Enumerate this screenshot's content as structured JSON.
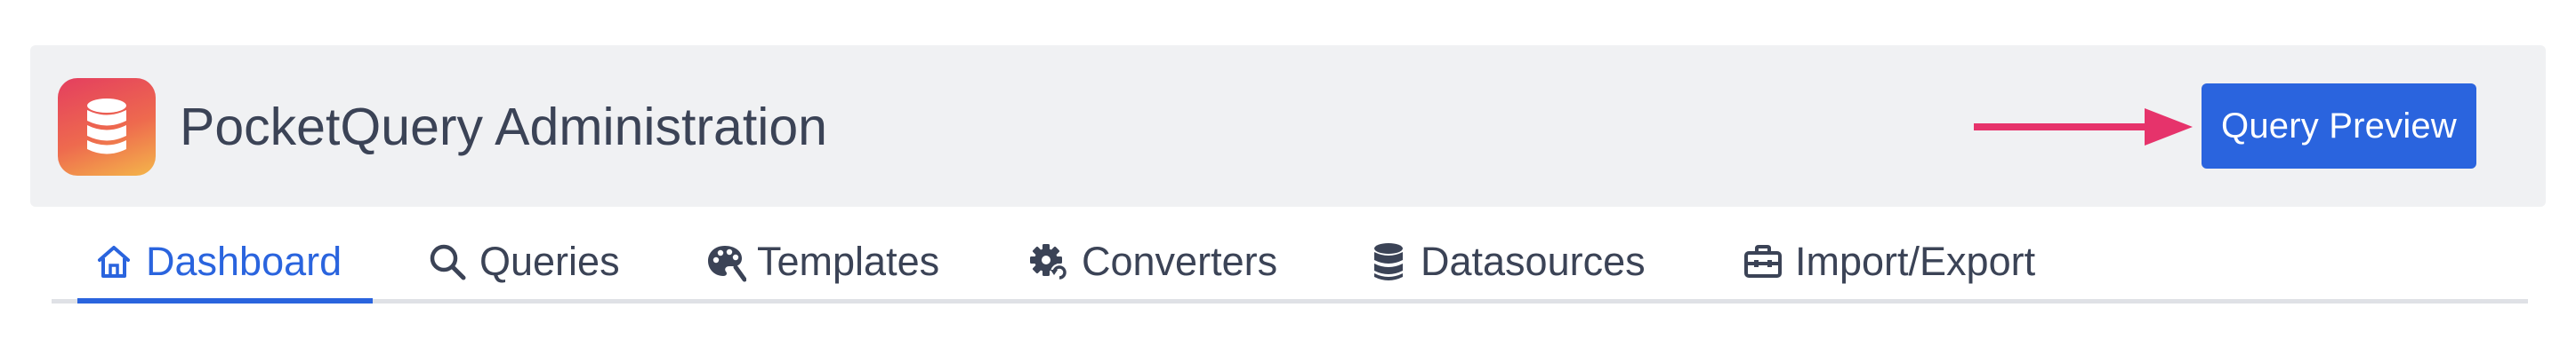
{
  "header": {
    "title": "PocketQuery Administration",
    "preview_button": "Query Preview",
    "logo_icon": "database-icon",
    "accent_color": "#2a64de",
    "arrow_color": "#e6336b"
  },
  "nav": {
    "active_tab": "Dashboard",
    "tabs": [
      {
        "label": "Dashboard",
        "icon": "home-icon"
      },
      {
        "label": "Queries",
        "icon": "search-icon"
      },
      {
        "label": "Templates",
        "icon": "palette-icon"
      },
      {
        "label": "Converters",
        "icon": "gear-convert-icon"
      },
      {
        "label": "Datasources",
        "icon": "database-icon"
      },
      {
        "label": "Import/Export",
        "icon": "toolbox-icon"
      }
    ]
  }
}
